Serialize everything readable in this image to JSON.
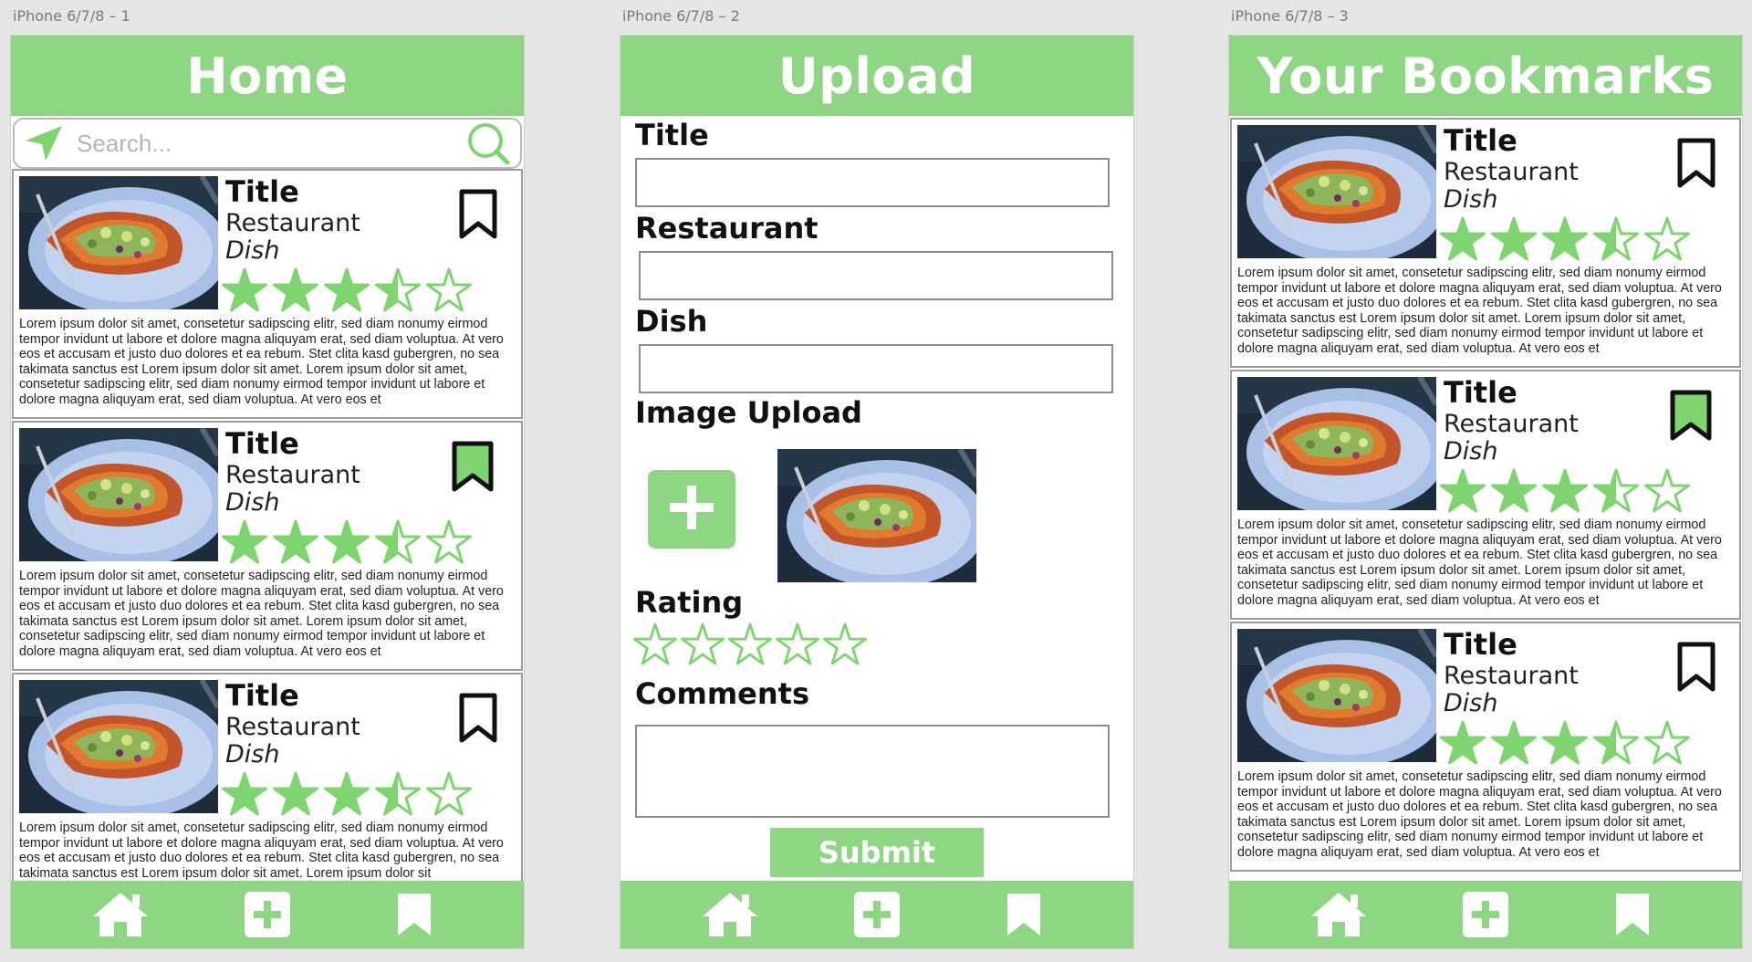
{
  "artboards": [
    {
      "label": "iPhone 6/7/8 – 1"
    },
    {
      "label": "iPhone 6/7/8 – 2"
    },
    {
      "label": "iPhone 6/7/8 – 3"
    }
  ],
  "colors": {
    "accent": "#8ed683",
    "star_fill": "#7ed56f"
  },
  "home": {
    "title": "Home",
    "search": {
      "placeholder": "Search...",
      "value": ""
    },
    "cards": [
      {
        "title": "Title",
        "restaurant": "Restaurant",
        "dish": "Dish",
        "rating": 3.5,
        "bookmarked": false,
        "text": "Lorem ipsum dolor sit amet, consetetur sadipscing elitr, sed diam nonumy eirmod tempor invidunt ut labore et dolore magna aliquyam erat, sed diam voluptua. At vero eos et accusam et justo duo dolores et ea rebum. Stet clita kasd gubergren, no sea takimata sanctus est Lorem ipsum dolor sit amet. Lorem ipsum dolor sit amet, consetetur sadipscing elitr, sed diam nonumy eirmod tempor invidunt ut labore et dolore magna aliquyam erat, sed diam voluptua. At vero eos et"
      },
      {
        "title": "Title",
        "restaurant": "Restaurant",
        "dish": "Dish",
        "rating": 3.5,
        "bookmarked": true,
        "text": "Lorem ipsum dolor sit amet, consetetur sadipscing elitr, sed diam nonumy eirmod tempor invidunt ut labore et dolore magna aliquyam erat, sed diam voluptua. At vero eos et accusam et justo duo dolores et ea rebum. Stet clita kasd gubergren, no sea takimata sanctus est Lorem ipsum dolor sit amet. Lorem ipsum dolor sit amet, consetetur sadipscing elitr, sed diam nonumy eirmod tempor invidunt ut labore et dolore magna aliquyam erat, sed diam voluptua. At vero eos et"
      },
      {
        "title": "Title",
        "restaurant": "Restaurant",
        "dish": "Dish",
        "rating": 3.5,
        "bookmarked": false,
        "text": "Lorem ipsum dolor sit amet, consetetur sadipscing elitr, sed diam nonumy eirmod tempor invidunt ut labore et dolore magna aliquyam erat, sed diam voluptua. At vero eos et accusam et justo duo dolores et ea rebum. Stet clita kasd gubergren, no sea takimata sanctus est Lorem ipsum dolor sit amet. Lorem ipsum dolor sit"
      }
    ]
  },
  "upload": {
    "title": "Upload",
    "labels": {
      "title": "Title",
      "restaurant": "Restaurant",
      "dish": "Dish",
      "image": "Image Upload",
      "rating": "Rating",
      "comments": "Comments"
    },
    "values": {
      "title": "",
      "restaurant": "",
      "dish": "",
      "comments": ""
    },
    "rating": 0,
    "submit_label": "Submit"
  },
  "bookmarks": {
    "title": "Your Bookmarks",
    "cards": [
      {
        "title": "Title",
        "restaurant": "Restaurant",
        "dish": "Dish",
        "rating": 3.5,
        "bookmarked": false,
        "text": "Lorem ipsum dolor sit amet, consetetur sadipscing elitr, sed diam nonumy eirmod tempor invidunt ut labore et dolore magna aliquyam erat, sed diam voluptua. At vero eos et accusam et justo duo dolores et ea rebum. Stet clita kasd gubergren, no sea takimata sanctus est Lorem ipsum dolor sit amet. Lorem ipsum dolor sit amet, consetetur sadipscing elitr, sed diam nonumy eirmod tempor invidunt ut labore et dolore magna aliquyam erat, sed diam voluptua. At vero eos et"
      },
      {
        "title": "Title",
        "restaurant": "Restaurant",
        "dish": "Dish",
        "rating": 3.5,
        "bookmarked": true,
        "text": "Lorem ipsum dolor sit amet, consetetur sadipscing elitr, sed diam nonumy eirmod tempor invidunt ut labore et dolore magna aliquyam erat, sed diam voluptua. At vero eos et accusam et justo duo dolores et ea rebum. Stet clita kasd gubergren, no sea takimata sanctus est Lorem ipsum dolor sit amet. Lorem ipsum dolor sit amet, consetetur sadipscing elitr, sed diam nonumy eirmod tempor invidunt ut labore et dolore magna aliquyam erat, sed diam voluptua. At vero eos et"
      },
      {
        "title": "Title",
        "restaurant": "Restaurant",
        "dish": "Dish",
        "rating": 3.5,
        "bookmarked": false,
        "text": "Lorem ipsum dolor sit amet, consetetur sadipscing elitr, sed diam nonumy eirmod tempor invidunt ut labore et dolore magna aliquyam erat, sed diam voluptua. At vero eos et accusam et justo duo dolores et ea rebum. Stet clita kasd gubergren, no sea takimata sanctus est Lorem ipsum dolor sit amet. Lorem ipsum dolor sit amet, consetetur sadipscing elitr, sed diam nonumy eirmod tempor invidunt ut labore et dolore magna aliquyam erat, sed diam voluptua. At vero eos et"
      }
    ]
  },
  "icons": {
    "location": "location-arrow-icon",
    "search": "search-icon",
    "home": "home-icon",
    "add": "plus-icon",
    "bookmark": "bookmark-icon"
  }
}
